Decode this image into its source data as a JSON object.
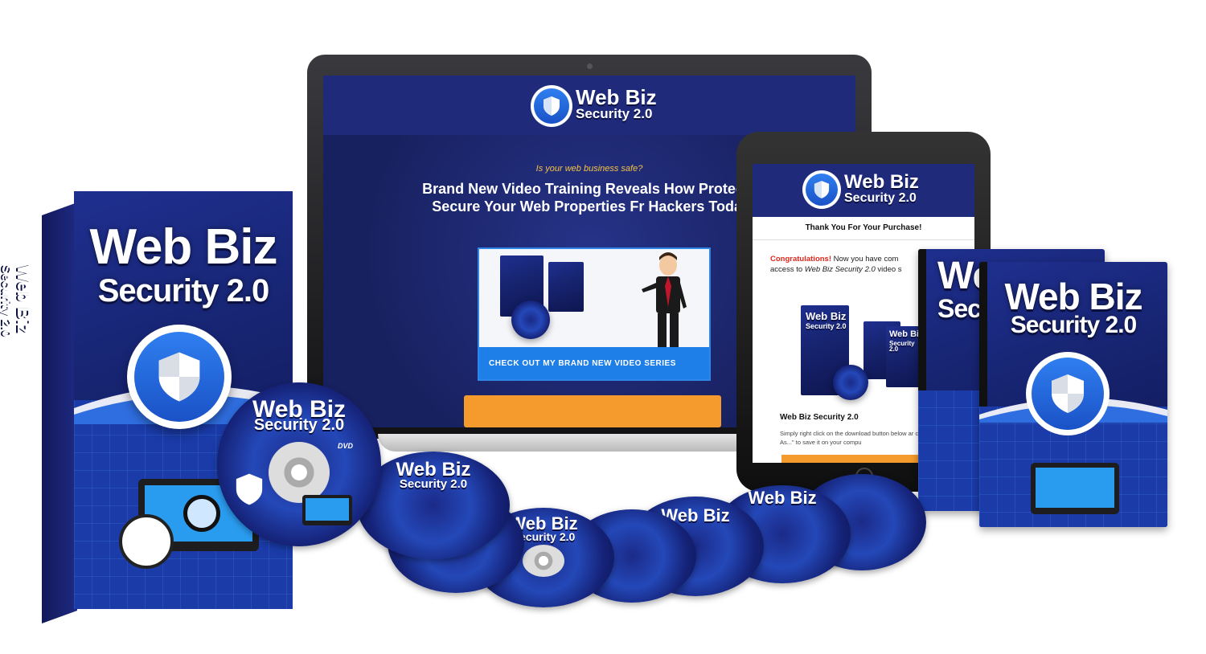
{
  "brand": {
    "name_line1": "Web Biz",
    "name_line2": "Security 2.0",
    "colors": {
      "navy": "#1b2466",
      "accent_blue": "#1f7fe8",
      "orange": "#f59a2c",
      "red": "#e0261b",
      "gold": "#f5c242"
    }
  },
  "laptop": {
    "tagline": "Is your web business safe?",
    "headline": "Brand New Video Training Reveals How Protect & Secure Your Web Properties Fr Hackers Today.",
    "video_cta": "CHECK OUT MY BRAND NEW VIDEO SERIES"
  },
  "tablet": {
    "thanks": "Thank You For Your Purchase!",
    "congrats_label": "Congratulations!",
    "congrats_text_1": " Now you have com",
    "congrats_text_2": "access to ",
    "congrats_product": "Web Biz Security 2.0",
    "congrats_text_3": " video s",
    "product_title": "Web Biz Security 2.0",
    "instructions": "Simply right click on the download button below ar choose \"Save Target As...\" to save it on your compu"
  },
  "box": {
    "spine_text_1": "Web Biz",
    "spine_text_2": "Security 2.0"
  },
  "dvd_cases": {
    "back_partial_1": "We",
    "back_partial_2": "Sec"
  },
  "disc": {
    "badge": "DVD"
  },
  "icons": [
    "shield-icon",
    "seo-magnifier-icon",
    "laptop-icon"
  ]
}
